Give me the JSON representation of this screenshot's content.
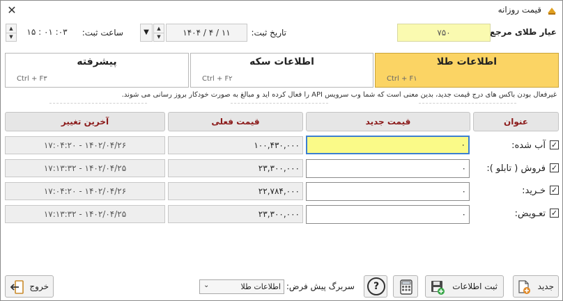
{
  "window": {
    "title": "قیمت روزانه",
    "close_glyph": "✕"
  },
  "top": {
    "ref_label": "عیار طلای مرجع:",
    "ref_value": "۷۵۰",
    "date_label": "تاریخ ثبت:",
    "date_value": "۱۴۰۴ / ۴ / ۱۱",
    "time_label": "ساعت ثبت:",
    "time_value": "۱۵ : ۰۱ :۰۳"
  },
  "tabs": [
    {
      "label": "اطلاعات طلا",
      "shortcut": "Ctrl + F۱",
      "active": true
    },
    {
      "label": "اطلاعات سکه",
      "shortcut": "Ctrl + F۲",
      "active": false
    },
    {
      "label": "پیشرفته",
      "shortcut": "Ctrl + F۳",
      "active": false
    }
  ],
  "info": "غیرفعال بودن باکس های درج قیمت جدید، بدین معنی است که شما وب سرویس API را فعال کرده اید و مبالغ به صورت خودکار بروز رسانی می شوند.",
  "columns": {
    "title": "عنوان",
    "new_price": "قیمت جدید",
    "current_price": "قیمت فعلی",
    "last_change": "آخرین تغییر"
  },
  "rows": [
    {
      "label": "آب شده:",
      "checked": true,
      "new_price": "۰",
      "current_price": "۱۰۰,۴۳۰,۰۰۰",
      "last_change": "۱۷:۰۴:۲۰ - ۱۴۰۲/۰۴/۲۶"
    },
    {
      "label": "فروش ( تابلو ):",
      "checked": true,
      "new_price": "۰",
      "current_price": "۲۳,۳۰۰,۰۰۰",
      "last_change": "۱۷:۱۳:۳۲ - ۱۴۰۲/۰۴/۲۵"
    },
    {
      "label": "خـرید:",
      "checked": true,
      "new_price": "۰",
      "current_price": "۲۲,۷۸۴,۰۰۰",
      "last_change": "۱۷:۰۴:۲۰ - ۱۴۰۲/۰۴/۲۶"
    },
    {
      "label": "تعـویض:",
      "checked": true,
      "new_price": "۰",
      "current_price": "۲۳,۳۰۰,۰۰۰",
      "last_change": "۱۷:۱۳:۳۲ - ۱۴۰۲/۰۴/۲۵"
    }
  ],
  "footer": {
    "new_label": "جدید",
    "save_label": "ثبت اطلاعات",
    "default_page_label": "سربرگ پیش فرض:",
    "default_page_value": "اطلاعات طلا",
    "help_glyph": "?",
    "exit_label": "خروج"
  },
  "colors": {
    "active_tab": "#fbd464",
    "header_text": "#8b1a1a",
    "ref_bg": "#fafab0",
    "focus_bg": "#fafa88"
  }
}
